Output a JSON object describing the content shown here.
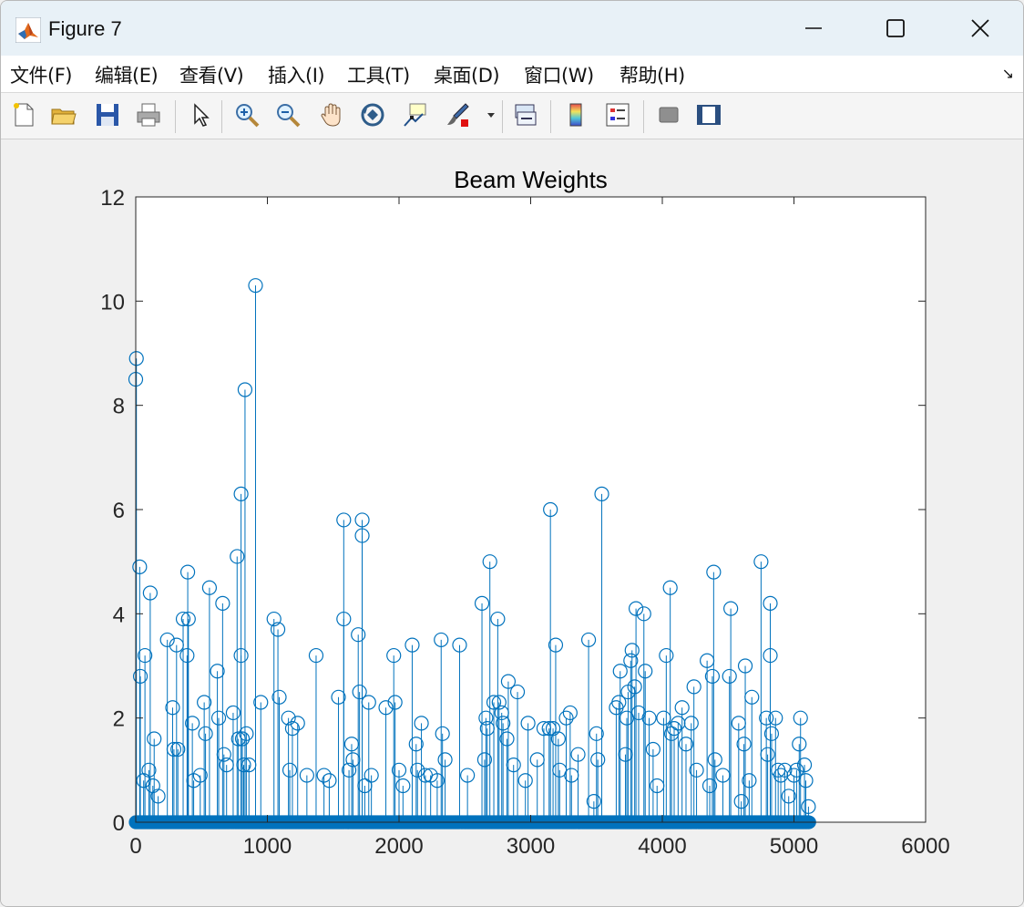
{
  "window": {
    "title": "Figure 7"
  },
  "menu": [
    {
      "label": "文件(F)"
    },
    {
      "label": "编辑(E)"
    },
    {
      "label": "查看(V)"
    },
    {
      "label": "插入(I)"
    },
    {
      "label": "工具(T)"
    },
    {
      "label": "桌面(D)"
    },
    {
      "label": "窗口(W)"
    },
    {
      "label": "帮助(H)"
    }
  ],
  "menu_overflow_icon": "arrow-icon",
  "toolbar": [
    {
      "name": "new-figure-icon"
    },
    {
      "name": "open-file-icon"
    },
    {
      "name": "save-icon"
    },
    {
      "name": "print-icon"
    },
    {
      "name": "pointer-icon"
    },
    {
      "name": "zoom-in-icon"
    },
    {
      "name": "zoom-out-icon"
    },
    {
      "name": "pan-icon"
    },
    {
      "name": "rotate-3d-icon"
    },
    {
      "name": "data-cursor-icon"
    },
    {
      "name": "brush-icon"
    },
    {
      "name": "link-plot-icon"
    },
    {
      "name": "colorbar-icon"
    },
    {
      "name": "legend-icon"
    },
    {
      "name": "hide-plot-tools-icon"
    },
    {
      "name": "show-plot-tools-icon"
    }
  ],
  "colors": {
    "series": "#0072bd",
    "axes": "#262626",
    "plot_bg": "#ffffff",
    "figure_bg": "#f0f0f0"
  },
  "chart_data": {
    "type": "stem",
    "title": "Beam Weights",
    "xlim": [
      0,
      6000
    ],
    "ylim": [
      0,
      12
    ],
    "xticks": [
      "0",
      "1000",
      "2000",
      "3000",
      "4000",
      "5000",
      "6000"
    ],
    "yticks": [
      "0",
      "2",
      "4",
      "6",
      "8",
      "10",
      "12"
    ],
    "x_range_of_points": [
      0,
      5120
    ],
    "grid": false,
    "series": [
      {
        "marker": "open-circle",
        "points": [
          [
            0,
            8.5
          ],
          [
            5,
            8.9
          ],
          [
            30,
            4.9
          ],
          [
            35,
            2.8
          ],
          [
            70,
            3.2
          ],
          [
            60,
            0.8
          ],
          [
            110,
            4.4
          ],
          [
            100,
            1.0
          ],
          [
            140,
            1.6
          ],
          [
            130,
            0.7
          ],
          [
            170,
            0.5
          ],
          [
            240,
            3.5
          ],
          [
            280,
            2.2
          ],
          [
            290,
            1.4
          ],
          [
            310,
            3.4
          ],
          [
            320,
            1.4
          ],
          [
            360,
            3.9
          ],
          [
            390,
            3.2
          ],
          [
            395,
            4.8
          ],
          [
            400,
            3.9
          ],
          [
            430,
            1.9
          ],
          [
            440,
            0.8
          ],
          [
            490,
            0.9
          ],
          [
            520,
            2.3
          ],
          [
            530,
            1.7
          ],
          [
            560,
            4.5
          ],
          [
            620,
            2.9
          ],
          [
            630,
            2.0
          ],
          [
            660,
            4.2
          ],
          [
            670,
            1.3
          ],
          [
            690,
            1.1
          ],
          [
            740,
            2.1
          ],
          [
            770,
            5.1
          ],
          [
            780,
            1.6
          ],
          [
            800,
            6.3
          ],
          [
            800,
            3.2
          ],
          [
            810,
            1.6
          ],
          [
            820,
            1.1
          ],
          [
            830,
            8.3
          ],
          [
            840,
            1.7
          ],
          [
            860,
            1.1
          ],
          [
            910,
            10.3
          ],
          [
            950,
            2.3
          ],
          [
            1050,
            3.9
          ],
          [
            1080,
            3.7
          ],
          [
            1090,
            2.4
          ],
          [
            1160,
            2.0
          ],
          [
            1170,
            1.0
          ],
          [
            1190,
            1.8
          ],
          [
            1230,
            1.9
          ],
          [
            1300,
            0.9
          ],
          [
            1370,
            3.2
          ],
          [
            1430,
            0.9
          ],
          [
            1470,
            0.8
          ],
          [
            1540,
            2.4
          ],
          [
            1580,
            3.9
          ],
          [
            1580,
            5.8
          ],
          [
            1620,
            1.0
          ],
          [
            1640,
            1.5
          ],
          [
            1650,
            1.2
          ],
          [
            1690,
            3.6
          ],
          [
            1700,
            2.5
          ],
          [
            1720,
            5.5
          ],
          [
            1720,
            5.8
          ],
          [
            1740,
            0.7
          ],
          [
            1770,
            2.3
          ],
          [
            1790,
            0.9
          ],
          [
            1900,
            2.2
          ],
          [
            1960,
            3.2
          ],
          [
            1970,
            2.3
          ],
          [
            2000,
            1.0
          ],
          [
            2030,
            0.7
          ],
          [
            2100,
            3.4
          ],
          [
            2130,
            1.5
          ],
          [
            2140,
            1.0
          ],
          [
            2170,
            1.9
          ],
          [
            2200,
            0.9
          ],
          [
            2240,
            0.9
          ],
          [
            2290,
            0.8
          ],
          [
            2320,
            3.5
          ],
          [
            2330,
            1.7
          ],
          [
            2350,
            1.2
          ],
          [
            2460,
            3.4
          ],
          [
            2520,
            0.9
          ],
          [
            2630,
            4.2
          ],
          [
            2650,
            1.2
          ],
          [
            2660,
            2.0
          ],
          [
            2670,
            1.8
          ],
          [
            2690,
            5.0
          ],
          [
            2720,
            2.3
          ],
          [
            2750,
            3.9
          ],
          [
            2760,
            2.3
          ],
          [
            2780,
            2.1
          ],
          [
            2790,
            1.9
          ],
          [
            2820,
            1.6
          ],
          [
            2830,
            2.7
          ],
          [
            2870,
            1.1
          ],
          [
            2900,
            2.5
          ],
          [
            2960,
            0.8
          ],
          [
            2980,
            1.9
          ],
          [
            3050,
            1.2
          ],
          [
            3100,
            1.8
          ],
          [
            3140,
            1.8
          ],
          [
            3150,
            6.0
          ],
          [
            3170,
            1.8
          ],
          [
            3190,
            3.4
          ],
          [
            3210,
            1.6
          ],
          [
            3220,
            1.0
          ],
          [
            3270,
            2.0
          ],
          [
            3300,
            2.1
          ],
          [
            3310,
            0.9
          ],
          [
            3360,
            1.3
          ],
          [
            3440,
            3.5
          ],
          [
            3480,
            0.4
          ],
          [
            3500,
            1.7
          ],
          [
            3510,
            1.2
          ],
          [
            3540,
            6.3
          ],
          [
            3650,
            2.2
          ],
          [
            3670,
            2.3
          ],
          [
            3680,
            2.9
          ],
          [
            3720,
            1.3
          ],
          [
            3730,
            2.0
          ],
          [
            3740,
            2.5
          ],
          [
            3760,
            3.1
          ],
          [
            3770,
            3.3
          ],
          [
            3790,
            2.6
          ],
          [
            3800,
            4.1
          ],
          [
            3820,
            2.1
          ],
          [
            3860,
            4.0
          ],
          [
            3870,
            2.9
          ],
          [
            3900,
            2.0
          ],
          [
            3930,
            1.4
          ],
          [
            3960,
            0.7
          ],
          [
            4010,
            2.0
          ],
          [
            4030,
            3.2
          ],
          [
            4060,
            4.5
          ],
          [
            4070,
            1.7
          ],
          [
            4090,
            1.8
          ],
          [
            4120,
            1.9
          ],
          [
            4150,
            2.2
          ],
          [
            4180,
            1.5
          ],
          [
            4220,
            1.9
          ],
          [
            4240,
            2.6
          ],
          [
            4260,
            1.0
          ],
          [
            4340,
            3.1
          ],
          [
            4360,
            0.7
          ],
          [
            4380,
            2.8
          ],
          [
            4390,
            4.8
          ],
          [
            4400,
            1.2
          ],
          [
            4460,
            0.9
          ],
          [
            4510,
            2.8
          ],
          [
            4520,
            4.1
          ],
          [
            4580,
            1.9
          ],
          [
            4600,
            0.4
          ],
          [
            4620,
            1.5
          ],
          [
            4630,
            3.0
          ],
          [
            4660,
            0.8
          ],
          [
            4680,
            2.4
          ],
          [
            4750,
            5.0
          ],
          [
            4790,
            2.0
          ],
          [
            4800,
            1.3
          ],
          [
            4820,
            4.2
          ],
          [
            4820,
            3.2
          ],
          [
            4830,
            1.7
          ],
          [
            4860,
            2.0
          ],
          [
            4880,
            1.0
          ],
          [
            4900,
            0.9
          ],
          [
            4930,
            1.0
          ],
          [
            4960,
            0.5
          ],
          [
            5000,
            0.9
          ],
          [
            5020,
            1.0
          ],
          [
            5040,
            1.5
          ],
          [
            5050,
            2.0
          ],
          [
            5080,
            1.1
          ],
          [
            5090,
            0.8
          ],
          [
            5110,
            0.3
          ]
        ]
      }
    ]
  }
}
